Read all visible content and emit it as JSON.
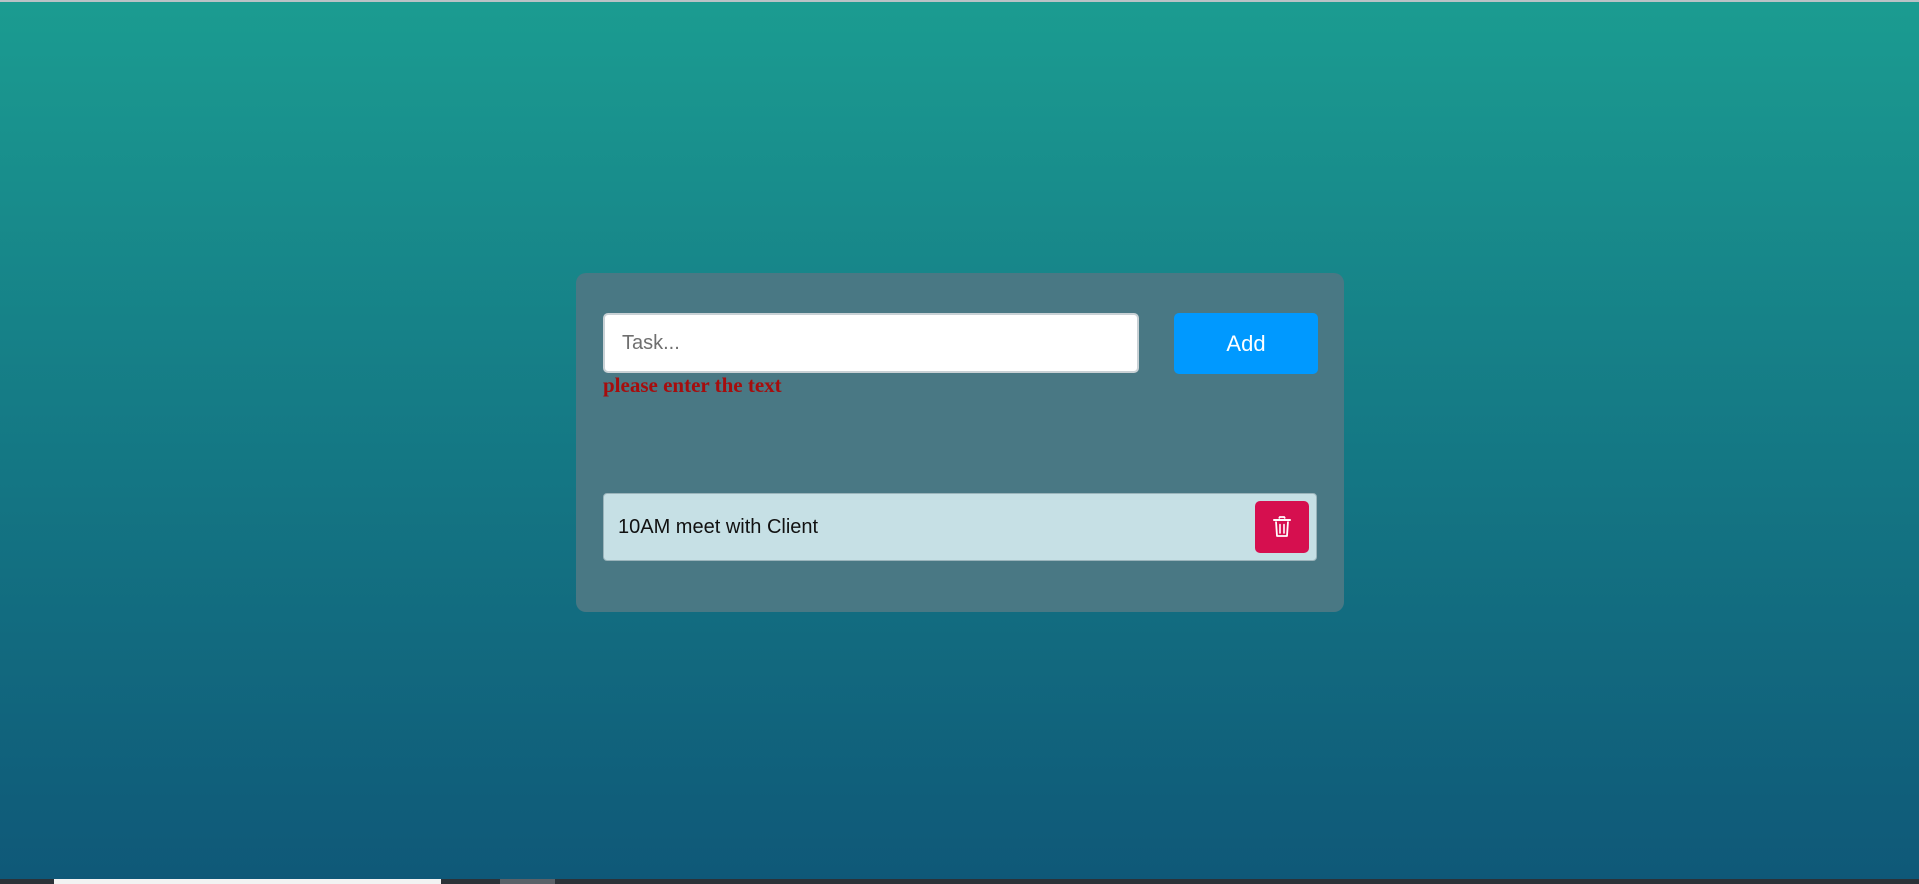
{
  "form": {
    "task_placeholder": "Task...",
    "task_value": "",
    "add_label": "Add",
    "error_message": "please enter the text"
  },
  "tasks": [
    {
      "text": "10AM meet with Client",
      "delete_icon": "trash-icon"
    }
  ],
  "colors": {
    "background_top": "#1b9c91",
    "background_bottom": "#0f5878",
    "card": "#497884",
    "add_button": "#0099ff",
    "error_text": "#a60d0d",
    "task_item": "#c6e0e5",
    "delete_button": "#d60f4f"
  }
}
